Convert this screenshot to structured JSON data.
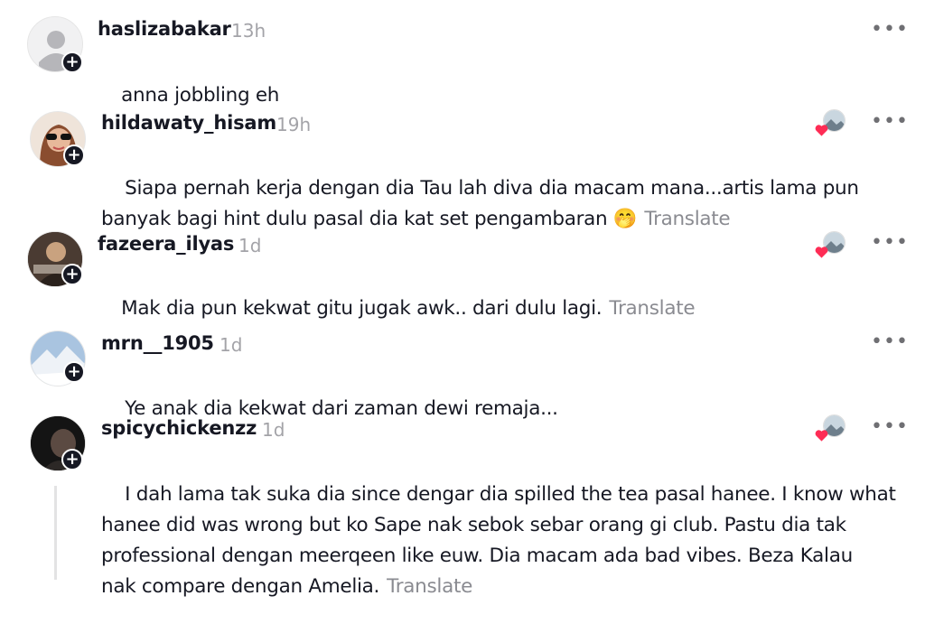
{
  "comments": [
    {
      "username": "haslizabakar",
      "time": "13h",
      "text": "anna jobbling eh",
      "translate": "",
      "liked": false
    },
    {
      "username": "hildawaty_hisam",
      "time": "19h",
      "text": "Siapa pernah kerja dengan dia Tau lah diva dia macam mana...artis lama pun\nbanyak bagi hint dulu pasal dia kat set pengambaran 🤭",
      "translate": "Translate",
      "liked": true
    },
    {
      "username": "fazeera_ilyas",
      "time": "1d",
      "text": "Mak dia pun kekwat gitu jugak awk.. dari dulu lagi.",
      "translate": "Translate",
      "liked": true
    },
    {
      "username": "mrn__1905",
      "time": "1d",
      "text": "Ye anak dia kekwat dari zaman dewi remaja...",
      "translate": "",
      "liked": false
    },
    {
      "username": "spicychickenzz",
      "time": "1d",
      "text": "I dah lama tak suka dia since dengar dia spilled the tea pasal hanee. I know what\nhanee did was wrong but ko Sape nak sebok sebar orang gi club. Pastu dia tak\nprofessional dengan meerqeen like euw. Dia macam ada bad vibes. Beza Kalau\nnak compare dengan Amelia.",
      "translate": "Translate",
      "liked": true
    }
  ],
  "icons": {
    "follow": "plus-icon",
    "more": "more-options-icon",
    "liked": "creator-liked-heart-icon"
  },
  "colors": {
    "heart": "#fe2c55",
    "muted": "#a3a3a8",
    "text": "#161823"
  }
}
